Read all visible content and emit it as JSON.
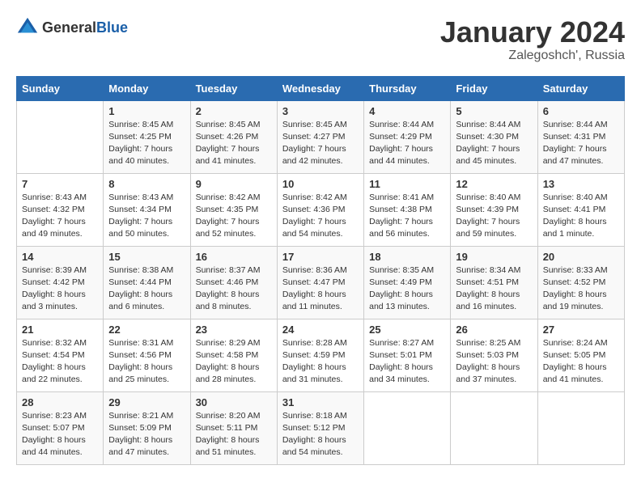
{
  "header": {
    "logo_general": "General",
    "logo_blue": "Blue",
    "month": "January 2024",
    "location": "Zalegoshch', Russia"
  },
  "days_of_week": [
    "Sunday",
    "Monday",
    "Tuesday",
    "Wednesday",
    "Thursday",
    "Friday",
    "Saturday"
  ],
  "weeks": [
    [
      {
        "day": "",
        "info": ""
      },
      {
        "day": "1",
        "info": "Sunrise: 8:45 AM\nSunset: 4:25 PM\nDaylight: 7 hours\nand 40 minutes."
      },
      {
        "day": "2",
        "info": "Sunrise: 8:45 AM\nSunset: 4:26 PM\nDaylight: 7 hours\nand 41 minutes."
      },
      {
        "day": "3",
        "info": "Sunrise: 8:45 AM\nSunset: 4:27 PM\nDaylight: 7 hours\nand 42 minutes."
      },
      {
        "day": "4",
        "info": "Sunrise: 8:44 AM\nSunset: 4:29 PM\nDaylight: 7 hours\nand 44 minutes."
      },
      {
        "day": "5",
        "info": "Sunrise: 8:44 AM\nSunset: 4:30 PM\nDaylight: 7 hours\nand 45 minutes."
      },
      {
        "day": "6",
        "info": "Sunrise: 8:44 AM\nSunset: 4:31 PM\nDaylight: 7 hours\nand 47 minutes."
      }
    ],
    [
      {
        "day": "7",
        "info": "Sunrise: 8:43 AM\nSunset: 4:32 PM\nDaylight: 7 hours\nand 49 minutes."
      },
      {
        "day": "8",
        "info": "Sunrise: 8:43 AM\nSunset: 4:34 PM\nDaylight: 7 hours\nand 50 minutes."
      },
      {
        "day": "9",
        "info": "Sunrise: 8:42 AM\nSunset: 4:35 PM\nDaylight: 7 hours\nand 52 minutes."
      },
      {
        "day": "10",
        "info": "Sunrise: 8:42 AM\nSunset: 4:36 PM\nDaylight: 7 hours\nand 54 minutes."
      },
      {
        "day": "11",
        "info": "Sunrise: 8:41 AM\nSunset: 4:38 PM\nDaylight: 7 hours\nand 56 minutes."
      },
      {
        "day": "12",
        "info": "Sunrise: 8:40 AM\nSunset: 4:39 PM\nDaylight: 7 hours\nand 59 minutes."
      },
      {
        "day": "13",
        "info": "Sunrise: 8:40 AM\nSunset: 4:41 PM\nDaylight: 8 hours\nand 1 minute."
      }
    ],
    [
      {
        "day": "14",
        "info": "Sunrise: 8:39 AM\nSunset: 4:42 PM\nDaylight: 8 hours\nand 3 minutes."
      },
      {
        "day": "15",
        "info": "Sunrise: 8:38 AM\nSunset: 4:44 PM\nDaylight: 8 hours\nand 6 minutes."
      },
      {
        "day": "16",
        "info": "Sunrise: 8:37 AM\nSunset: 4:46 PM\nDaylight: 8 hours\nand 8 minutes."
      },
      {
        "day": "17",
        "info": "Sunrise: 8:36 AM\nSunset: 4:47 PM\nDaylight: 8 hours\nand 11 minutes."
      },
      {
        "day": "18",
        "info": "Sunrise: 8:35 AM\nSunset: 4:49 PM\nDaylight: 8 hours\nand 13 minutes."
      },
      {
        "day": "19",
        "info": "Sunrise: 8:34 AM\nSunset: 4:51 PM\nDaylight: 8 hours\nand 16 minutes."
      },
      {
        "day": "20",
        "info": "Sunrise: 8:33 AM\nSunset: 4:52 PM\nDaylight: 8 hours\nand 19 minutes."
      }
    ],
    [
      {
        "day": "21",
        "info": "Sunrise: 8:32 AM\nSunset: 4:54 PM\nDaylight: 8 hours\nand 22 minutes."
      },
      {
        "day": "22",
        "info": "Sunrise: 8:31 AM\nSunset: 4:56 PM\nDaylight: 8 hours\nand 25 minutes."
      },
      {
        "day": "23",
        "info": "Sunrise: 8:29 AM\nSunset: 4:58 PM\nDaylight: 8 hours\nand 28 minutes."
      },
      {
        "day": "24",
        "info": "Sunrise: 8:28 AM\nSunset: 4:59 PM\nDaylight: 8 hours\nand 31 minutes."
      },
      {
        "day": "25",
        "info": "Sunrise: 8:27 AM\nSunset: 5:01 PM\nDaylight: 8 hours\nand 34 minutes."
      },
      {
        "day": "26",
        "info": "Sunrise: 8:25 AM\nSunset: 5:03 PM\nDaylight: 8 hours\nand 37 minutes."
      },
      {
        "day": "27",
        "info": "Sunrise: 8:24 AM\nSunset: 5:05 PM\nDaylight: 8 hours\nand 41 minutes."
      }
    ],
    [
      {
        "day": "28",
        "info": "Sunrise: 8:23 AM\nSunset: 5:07 PM\nDaylight: 8 hours\nand 44 minutes."
      },
      {
        "day": "29",
        "info": "Sunrise: 8:21 AM\nSunset: 5:09 PM\nDaylight: 8 hours\nand 47 minutes."
      },
      {
        "day": "30",
        "info": "Sunrise: 8:20 AM\nSunset: 5:11 PM\nDaylight: 8 hours\nand 51 minutes."
      },
      {
        "day": "31",
        "info": "Sunrise: 8:18 AM\nSunset: 5:12 PM\nDaylight: 8 hours\nand 54 minutes."
      },
      {
        "day": "",
        "info": ""
      },
      {
        "day": "",
        "info": ""
      },
      {
        "day": "",
        "info": ""
      }
    ]
  ]
}
